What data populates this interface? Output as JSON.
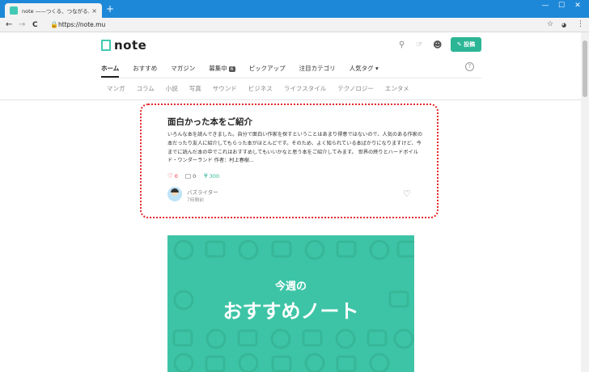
{
  "browser": {
    "tab_title": "note ——つくる、つながる、とどける。",
    "tab_close": "×",
    "new_tab": "+",
    "window_controls": [
      "—",
      "☐",
      "✕"
    ],
    "url": "https://note.mu",
    "back": "←",
    "forward": "→",
    "reload": "C",
    "right_icons": [
      "☆",
      "⋮"
    ],
    "accent": "#1e88d8"
  },
  "header": {
    "logo": "note",
    "post_button": "✎ 投稿",
    "brand_color": "#41c9b4"
  },
  "main_nav": [
    {
      "label": "ホーム",
      "active": true
    },
    {
      "label": "おすすめ",
      "active": false
    },
    {
      "label": "マガジン",
      "active": false
    },
    {
      "label": "募集中",
      "badge": "6",
      "active": false
    },
    {
      "label": "ピックアップ",
      "active": false
    },
    {
      "label": "注目カテゴリ",
      "active": false
    },
    {
      "label": "人気タグ ▾",
      "active": false
    }
  ],
  "help": "?",
  "sub_nav": [
    "マンガ",
    "コラム",
    "小説",
    "写真",
    "サウンド",
    "ビジネス",
    "ライフスタイル",
    "テクノロジー",
    "エンタメ"
  ],
  "card": {
    "title": "面白かった本をご紹介",
    "body": "いろんな本を読んできました。自分で面白い作家を探すということはあまり得意ではないので、人気のある作家の本だったり友人に紹介してもらった本がほとんどです。そのため、よく知られている本ばかりになりますけど、今までに読んだ本の中でこれはおすすめしてもいいかなと思う本をご紹介してみます。 世界の終りとハードボイルド・ワンダーランド 作者：村上春樹...",
    "likes": "0",
    "comments": "0",
    "price": "300",
    "author": "バズライター",
    "time": "7時間前",
    "highlight_color": "#e5262a"
  },
  "banner": {
    "subtitle": "今週の",
    "title": "おすすめノート",
    "color": "#3dc4a6"
  }
}
